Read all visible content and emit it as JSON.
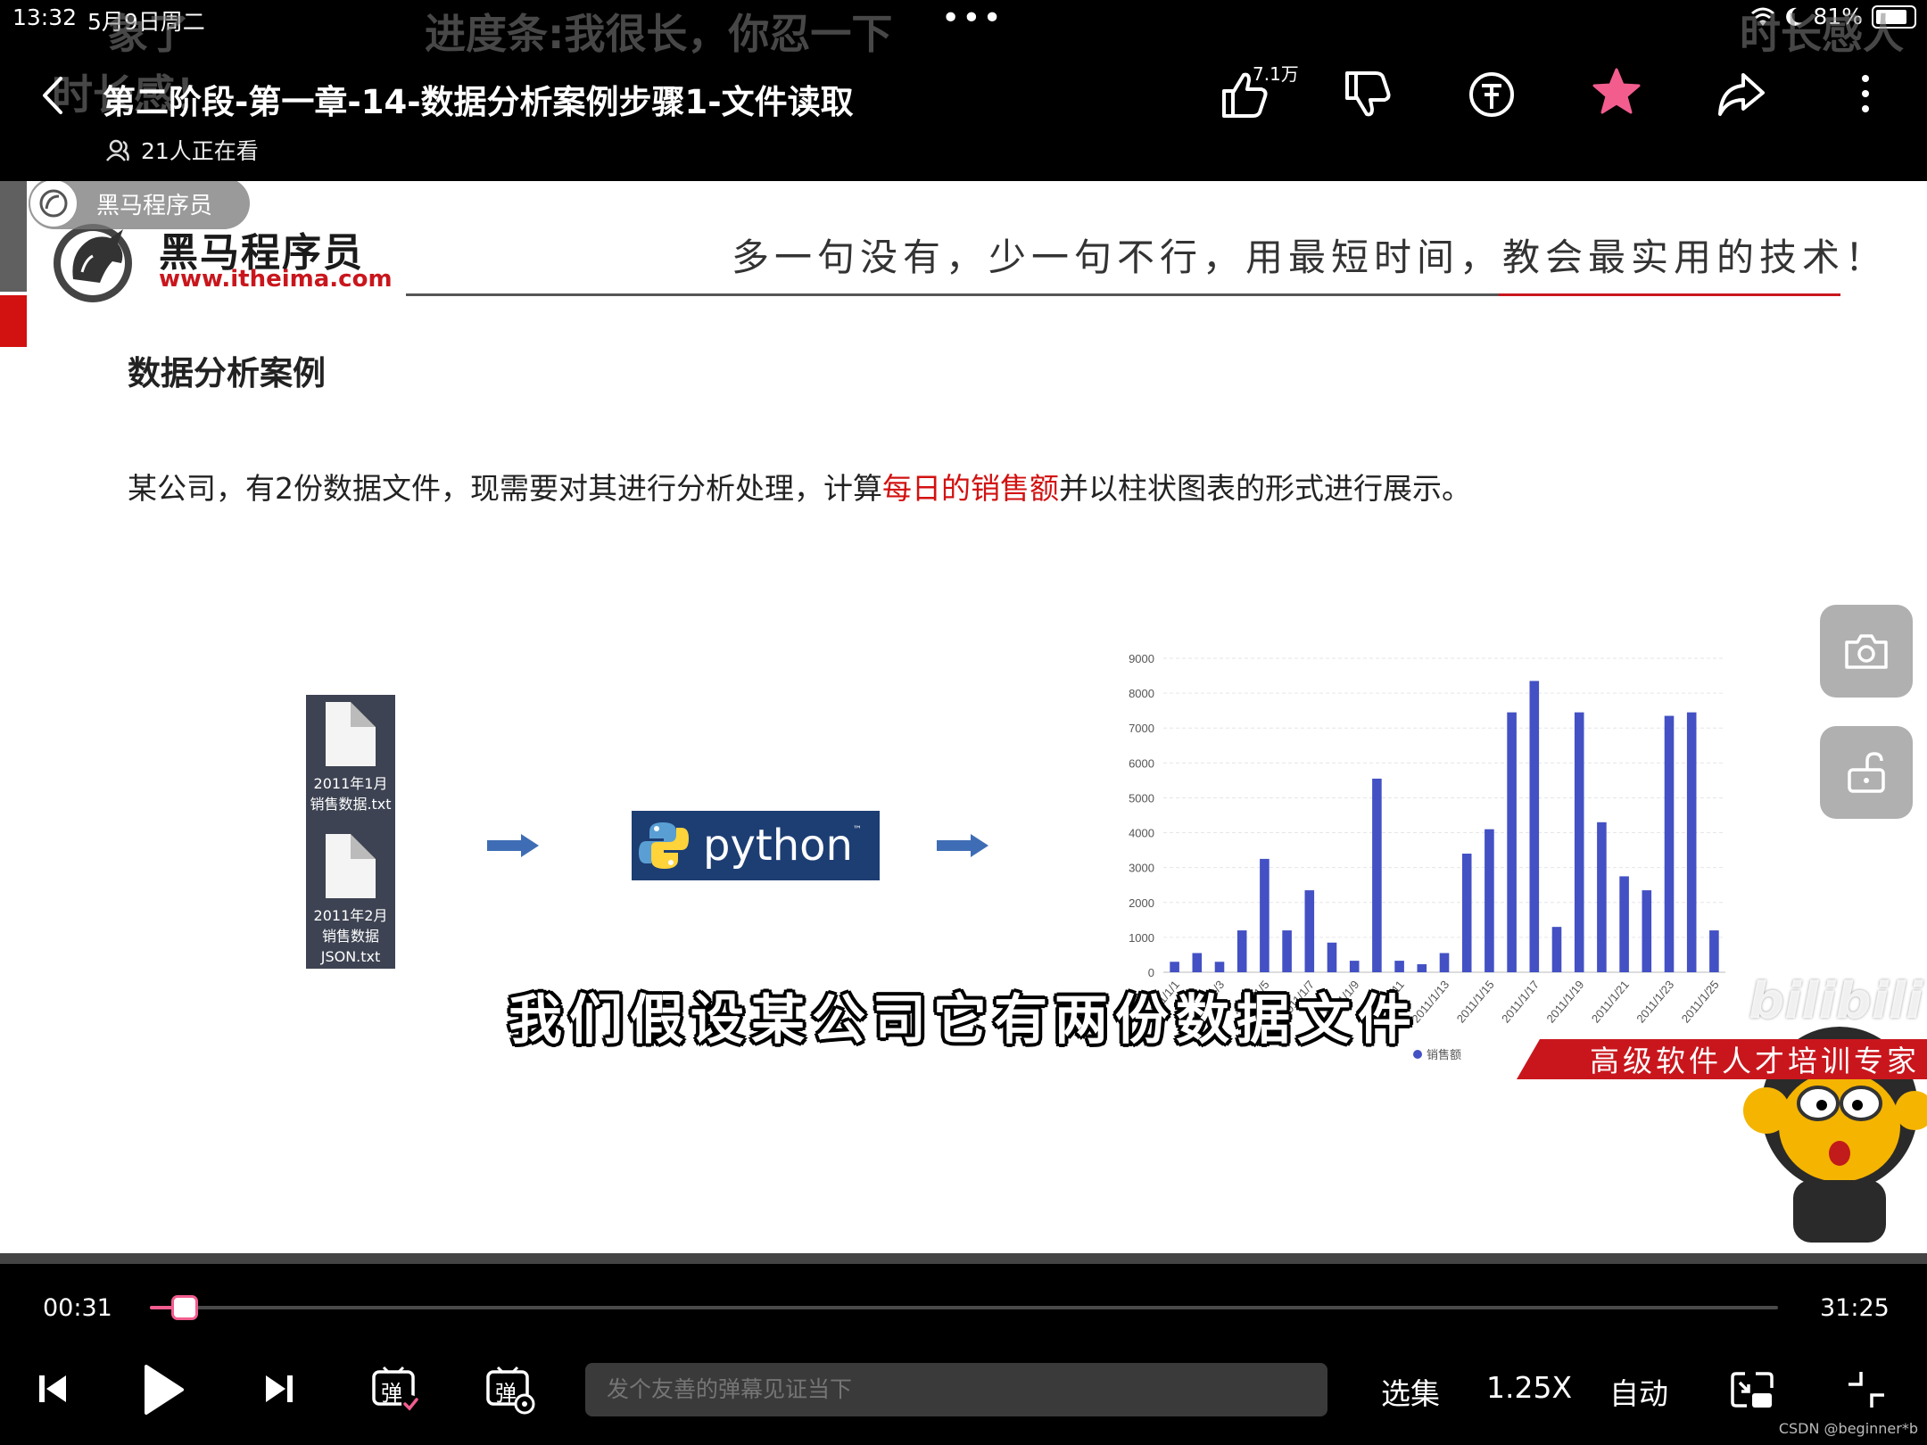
{
  "status_bar": {
    "time": "13:32",
    "date": "5月9日周二",
    "battery": "81%",
    "battery_level": 0.81
  },
  "ghost_danmaku": [
    "象了",
    "进度条:我很长，你忍一下",
    "时长感人",
    "时长感！"
  ],
  "header": {
    "title": "第二阶段-第一章-14-数据分析案例步骤1-文件读取",
    "viewers": "21人正在看",
    "like_count": "7.1万"
  },
  "slide": {
    "badge": "黑马程序员",
    "logo_cn": "黑马程序员",
    "logo_url": "www.itheima.com",
    "slogan": "多一句没有，少一句不行，用最短时间，教会最实用的技术！",
    "heading": "数据分析案例",
    "desc_before": "某公司，有2份数据文件，现需要对其进行分析处理，计算",
    "desc_highlight": "每日的销售额",
    "desc_after": "并以柱状图表的形式进行展示。",
    "file1_line1": "2011年1月",
    "file1_line2": "销售数据.txt",
    "file2_line1": "2011年2月",
    "file2_line2": "销售数据",
    "file2_line3": "JSON.txt",
    "python_label": "python",
    "python_tm": "™",
    "subtitle": "我们假设某公司它有两份数据文件",
    "watermark": "bilibili",
    "banner": "高级软件人才培训专家"
  },
  "chart_data": {
    "type": "bar",
    "categories": [
      "2011/1/1",
      "2011/1/2",
      "2011/1/3",
      "2011/1/4",
      "2011/1/5",
      "2011/1/6",
      "2011/1/7",
      "2011/1/8",
      "2011/1/9",
      "2011/1/10",
      "2011/1/11",
      "2011/1/12",
      "2011/1/13",
      "2011/1/14",
      "2011/1/15",
      "2011/1/16",
      "2011/1/17",
      "2011/1/18",
      "2011/1/19",
      "2011/1/20",
      "2011/1/21",
      "2011/1/22",
      "2011/1/23",
      "2011/1/24",
      "2011/1/25"
    ],
    "tick_labels": [
      "2011/1/1",
      "2011/1/3",
      "2011/1/5",
      "2011/1/7",
      "2011/1/9",
      "2011/1/11",
      "2011/1/13",
      "2011/1/15",
      "2011/1/17",
      "2011/1/19",
      "2011/1/21",
      "2011/1/23",
      "2011/1/25"
    ],
    "series": [
      {
        "name": "销售额",
        "values": [
          300,
          550,
          300,
          1200,
          3250,
          1200,
          2350,
          850,
          330,
          5550,
          330,
          230,
          550,
          3400,
          4100,
          7450,
          8350,
          1300,
          7450,
          4300,
          2750,
          2350,
          7350,
          7450,
          1200
        ],
        "color": "#4351c4"
      }
    ],
    "yticks": [
      0,
      1000,
      2000,
      3000,
      4000,
      5000,
      6000,
      7000,
      8000,
      9000
    ],
    "ylim": [
      0,
      9000
    ],
    "grid": true,
    "legend_position": "bottom"
  },
  "controls": {
    "current_time": "00:31",
    "duration": "31:25",
    "progress": 0.0165,
    "danmaku_placeholder": "发个友善的弹幕见证当下",
    "episodes_label": "选集",
    "speed_label": "1.25X",
    "quality_label": "自动",
    "danmaku_toggle_label": "弹",
    "danmaku_settings_label": "弹"
  },
  "watermark_corner": "CSDN @beginner*b"
}
